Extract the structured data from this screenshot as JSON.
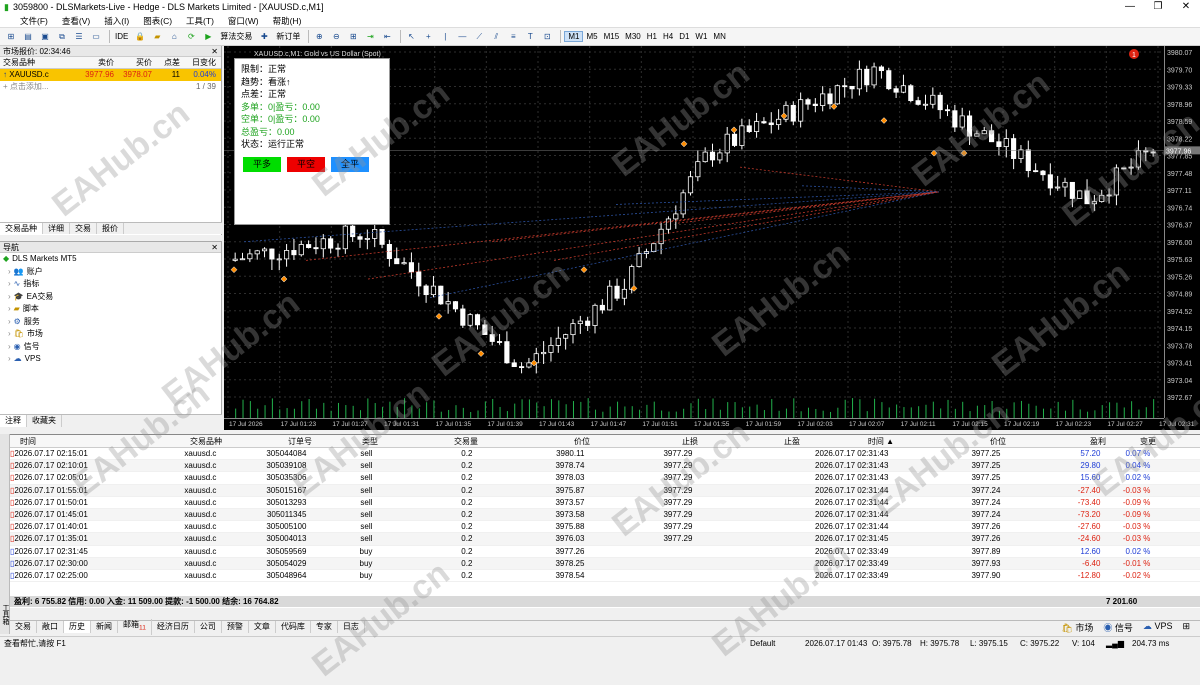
{
  "window": {
    "title": "3059800 - DLSMarkets-Live - Hedge - DLS Markets Limited - [XAUUSD.c,M1]",
    "min": "—",
    "max": "❐",
    "close": "✕"
  },
  "menu": [
    "文件(F)",
    "查看(V)",
    "插入(I)",
    "图表(C)",
    "工具(T)",
    "窗口(W)",
    "帮助(H)"
  ],
  "toolbar": {
    "algo": "算法交易",
    "neworder": "新订单",
    "ide": "IDE",
    "timeframes": [
      "M1",
      "M5",
      "M15",
      "M30",
      "H1",
      "H4",
      "D1",
      "W1",
      "MN"
    ],
    "active_tf": "M1"
  },
  "market_watch": {
    "title": "市场报价: 02:34:46",
    "cols": [
      "交易品种",
      "卖价",
      "买价",
      "点差",
      "日变化"
    ],
    "row": {
      "symbol": "XAUUSD.c",
      "bid": "3977.96",
      "ask": "3978.07",
      "spread": "11",
      "change": "0.04%"
    },
    "add": "点击添加...",
    "count": "1 / 39",
    "tabs": [
      "交易品种",
      "详细",
      "交易",
      "报价"
    ]
  },
  "navigator": {
    "title": "导航",
    "root": "DLS Markets MT5",
    "items": [
      "账户",
      "指标",
      "EA交易",
      "脚本",
      "服务",
      "市场",
      "信号",
      "VPS"
    ],
    "tabs": [
      "注释",
      "收藏夹"
    ]
  },
  "chart": {
    "symbol_label": "XAUUSD.c,M1: Gold vs US Dollar (Spot)",
    "badge": "1",
    "current_price": "3977.96",
    "yticks": [
      "3980.07",
      "3979.70",
      "3979.33",
      "3978.96",
      "3978.59",
      "3978.22",
      "3977.85",
      "3977.48",
      "3977.11",
      "3976.74",
      "3976.37",
      "3976.00",
      "3975.63",
      "3975.26",
      "3974.89",
      "3974.52",
      "3974.15",
      "3973.78",
      "3973.41",
      "3973.04",
      "3972.67"
    ],
    "xticks": [
      "17 Jul 2026",
      "17 Jul 01:23",
      "17 Jul 01:27",
      "17 Jul 01:31",
      "17 Jul 01:35",
      "17 Jul 01:39",
      "17 Jul 01:43",
      "17 Jul 01:47",
      "17 Jul 01:51",
      "17 Jul 01:55",
      "17 Jul 01:59",
      "17 Jul 02:03",
      "17 Jul 02:07",
      "17 Jul 02:11",
      "17 Jul 02:15",
      "17 Jul 02:19",
      "17 Jul 02:23",
      "17 Jul 02:27",
      "17 Jul 02:31"
    ],
    "colors": {
      "bull": "#ffffff",
      "bear": "#ffffff",
      "grid": "#3a3a3a",
      "volume": "#22b14c",
      "sell_line": "#c0392b",
      "buy_line": "#2a4f9c"
    }
  },
  "ea_panel": {
    "lines": [
      "限制：正常",
      "趋势：看涨↑",
      "点差：正常",
      "多单：0|盈亏：0.00",
      "空单：0|盈亏：0.00",
      "总盈亏：0.00",
      "状态：运行正常"
    ],
    "buttons": [
      {
        "label": "平多",
        "color": "#00dd00"
      },
      {
        "label": "平空",
        "color": "#ee0000"
      },
      {
        "label": "全平",
        "color": "#1e90ff"
      }
    ]
  },
  "terminal": {
    "cols": [
      "时间",
      "交易品种",
      "订单号",
      "类型",
      "交易量",
      "价位",
      "止损",
      "止盈",
      "时间 ▲",
      "价位",
      "盈利",
      "变更"
    ],
    "rows": [
      [
        "2026.07.17 02:15:01",
        "xauusd.c",
        "305044084",
        "sell",
        "0.2",
        "3980.11",
        "3977.29",
        "",
        "2026.07.17 02:31:43",
        "3977.25",
        "57.20",
        "0.07 %"
      ],
      [
        "2026.07.17 02:10:01",
        "xauusd.c",
        "305039108",
        "sell",
        "0.2",
        "3978.74",
        "3977.29",
        "",
        "2026.07.17 02:31:43",
        "3977.25",
        "29.80",
        "0.04 %"
      ],
      [
        "2026.07.17 02:05:01",
        "xauusd.c",
        "305035306",
        "sell",
        "0.2",
        "3978.03",
        "3977.29",
        "",
        "2026.07.17 02:31:43",
        "3977.25",
        "15.60",
        "0.02 %"
      ],
      [
        "2026.07.17 01:55:01",
        "xauusd.c",
        "305015167",
        "sell",
        "0.2",
        "3975.87",
        "3977.29",
        "",
        "2026.07.17 02:31:44",
        "3977.24",
        "-27.40",
        "-0.03 %"
      ],
      [
        "2026.07.17 01:50:01",
        "xauusd.c",
        "305013293",
        "sell",
        "0.2",
        "3973.57",
        "3977.29",
        "",
        "2026.07.17 02:31:44",
        "3977.24",
        "-73.40",
        "-0.09 %"
      ],
      [
        "2026.07.17 01:45:01",
        "xauusd.c",
        "305011345",
        "sell",
        "0.2",
        "3973.58",
        "3977.29",
        "",
        "2026.07.17 02:31:44",
        "3977.24",
        "-73.20",
        "-0.09 %"
      ],
      [
        "2026.07.17 01:40:01",
        "xauusd.c",
        "305005100",
        "sell",
        "0.2",
        "3975.88",
        "3977.29",
        "",
        "2026.07.17 02:31:44",
        "3977.26",
        "-27.60",
        "-0.03 %"
      ],
      [
        "2026.07.17 01:35:01",
        "xauusd.c",
        "305004013",
        "sell",
        "0.2",
        "3976.03",
        "3977.29",
        "",
        "2026.07.17 02:31:45",
        "3977.26",
        "-24.60",
        "-0.03 %"
      ],
      [
        "2026.07.17 02:31:45",
        "xauusd.c",
        "305059569",
        "buy",
        "0.2",
        "3977.26",
        "",
        "",
        "2026.07.17 02:33:49",
        "3977.89",
        "12.60",
        "0.02 %"
      ],
      [
        "2026.07.17 02:30:00",
        "xauusd.c",
        "305054029",
        "buy",
        "0.2",
        "3978.25",
        "",
        "",
        "2026.07.17 02:33:49",
        "3977.93",
        "-6.40",
        "-0.01 %"
      ],
      [
        "2026.07.17 02:25:00",
        "xauusd.c",
        "305048964",
        "buy",
        "0.2",
        "3978.54",
        "",
        "",
        "2026.07.17 02:33:49",
        "3977.90",
        "-12.80",
        "-0.02 %"
      ]
    ],
    "summary": "盈利: 6 755.82  信用: 0.00  入金: 11 509.00  提款: -1 500.00  结余: 16 764.82",
    "summary_total": "7 201.60",
    "tabs": [
      "交易",
      "敞口",
      "历史",
      "新闻",
      "邮箱",
      "经济日历",
      "公司",
      "预警",
      "文章",
      "代码库",
      "专家",
      "日志"
    ],
    "mail_count": "11",
    "right_tabs": [
      "市场",
      "信号",
      "VPS"
    ],
    "tools_label": "工具箱"
  },
  "status": {
    "help": "查看帮忙,请按 F1",
    "profile": "Default",
    "datetime": "2026.07.17 01:43",
    "o": "O: 3975.78",
    "h": "H: 3975.78",
    "l": "L: 3975.15",
    "c": "C: 3975.22",
    "v": "V: 104",
    "ping": "204.73 ms"
  },
  "watermark": "EAHub.cn"
}
